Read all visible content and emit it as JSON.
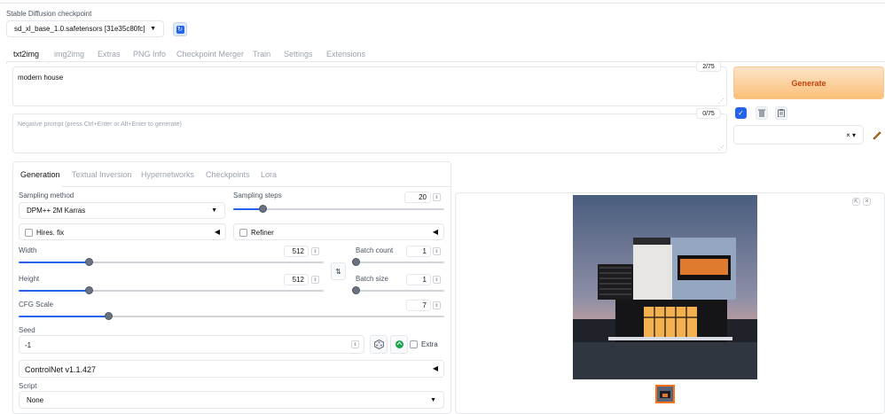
{
  "checkpoint": {
    "label": "Stable Diffusion checkpoint",
    "value": "sd_xl_base_1.0.safetensors [31e35c80fc]"
  },
  "main_tabs": [
    "txt2img",
    "img2img",
    "Extras",
    "PNG Info",
    "Checkpoint Merger",
    "Train",
    "Settings",
    "Extensions"
  ],
  "prompt": {
    "value": "modern house",
    "counter": "2/75"
  },
  "negative_prompt": {
    "placeholder": "Negative prompt (press Ctrl+Enter or Alt+Enter to generate)",
    "counter": "0/75"
  },
  "generate_label": "Generate",
  "style_select_value": "",
  "sub_tabs": [
    "Generation",
    "Textual Inversion",
    "Hypernetworks",
    "Checkpoints",
    "Lora"
  ],
  "sampling_method": {
    "label": "Sampling method",
    "value": "DPM++ 2M Karras"
  },
  "sampling_steps": {
    "label": "Sampling steps",
    "value": "20",
    "fraction": 0.14
  },
  "hires_fix": {
    "label": "Hires. fix"
  },
  "refiner": {
    "label": "Refiner"
  },
  "width": {
    "label": "Width",
    "value": "512",
    "fraction": 0.23
  },
  "height": {
    "label": "Height",
    "value": "512",
    "fraction": 0.23
  },
  "batch_count": {
    "label": "Batch count",
    "value": "1",
    "fraction": 0.0
  },
  "batch_size": {
    "label": "Batch size",
    "value": "1",
    "fraction": 0.0
  },
  "cfg_scale": {
    "label": "CFG Scale",
    "value": "7",
    "fraction": 0.21
  },
  "seed": {
    "label": "Seed",
    "value": "-1",
    "extra_label": "Extra"
  },
  "controlnet": {
    "label": "ControlNet v1.1.427"
  },
  "script": {
    "label": "Script",
    "value": "None"
  },
  "icons": {
    "refresh": "refresh-icon",
    "swap": "swap-icon",
    "dice": "dice-icon",
    "recycle": "recycle-icon",
    "trash": "trash-icon",
    "clipboard": "clipboard-icon",
    "check": "check-icon",
    "pencil": "pencil-icon"
  },
  "colors": {
    "accent": "#2563eb",
    "generate_start": "#fde4c8",
    "generate_end": "#fbbf78",
    "generate_text": "#c2410c"
  }
}
